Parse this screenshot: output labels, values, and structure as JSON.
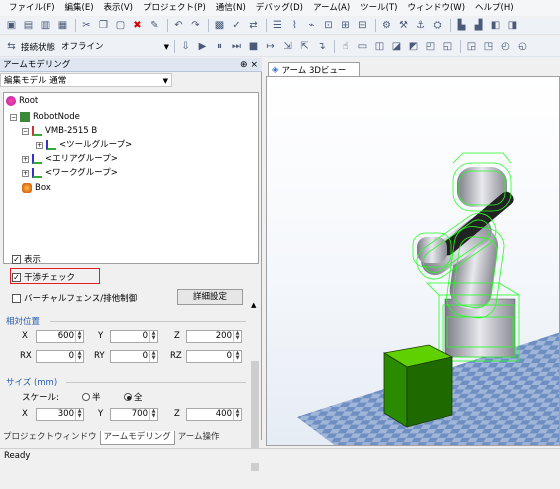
{
  "menu": [
    {
      "label": "ファイル(F)"
    },
    {
      "label": "編集(E)"
    },
    {
      "label": "表示(V)"
    },
    {
      "label": "プロジェクト(P)"
    },
    {
      "label": "通信(N)"
    },
    {
      "label": "デバッグ(D)"
    },
    {
      "label": "アーム(A)"
    },
    {
      "label": "ツール(T)"
    },
    {
      "label": "ウィンドウ(W)"
    },
    {
      "label": "ヘルプ(H)"
    }
  ],
  "toolbar2": {
    "conn_label": "接続状態",
    "conn_value": "オフライン"
  },
  "pane": {
    "title": "アームモデリング",
    "pin": "⊕ ×",
    "editmode": "編集モデル 通常",
    "tree": [
      {
        "label": "Root",
        "icon": "root-icon"
      },
      {
        "label": "RobotNode",
        "icon": "robot-node-icon"
      },
      {
        "label": "VMB-2515 B",
        "icon": "robot-arm-icon"
      },
      {
        "label": "<ツールグループ>",
        "icon": "axis-icon"
      },
      {
        "label": "<エリアグループ>",
        "icon": "axis-icon"
      },
      {
        "label": "<ワークグループ>",
        "icon": "axis-icon"
      },
      {
        "label": "Box",
        "icon": "box-icon"
      }
    ],
    "show_label": "表示",
    "collision_label": "干渉チェック",
    "fence_label": "バーチャルフェンス/排他制御",
    "detail_button": "詳細設定",
    "relpos": {
      "title": "相対位置",
      "x_label": "X",
      "x": "600",
      "y_label": "Y",
      "y": "0",
      "z_label": "Z",
      "z": "200",
      "rx_label": "RX",
      "rx": "0",
      "ry_label": "RY",
      "ry": "0",
      "rz_label": "RZ",
      "rz": "0"
    },
    "size": {
      "title": "サイズ (mm)",
      "scale_label": "スケール:",
      "half": "半",
      "full": "全",
      "x_label": "X",
      "x": "300",
      "y_label": "Y",
      "y": "700",
      "z_label": "Z",
      "z": "400"
    },
    "tabs": [
      "プロジェクトウィンドウ",
      "アームモデリング",
      "アーム操作"
    ]
  },
  "view": {
    "tab_label": "アーム 3Dビュー"
  },
  "status": "Ready",
  "colors": {
    "accent": "#2a5db0",
    "highlight_border": "#e02020",
    "box_green": "#2a8a00",
    "wire": "#22ff22"
  }
}
